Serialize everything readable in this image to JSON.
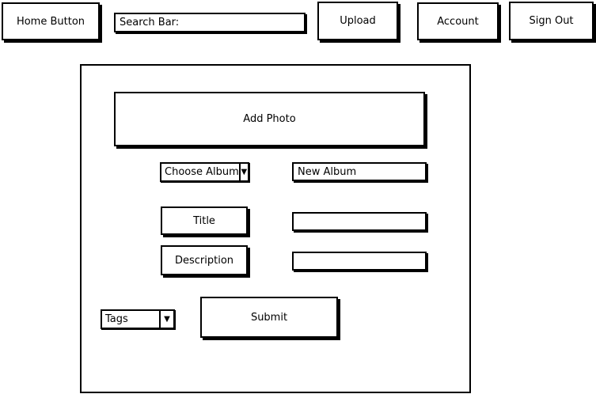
{
  "nav": {
    "home_label": "Home Button",
    "search_label": "Search Bar:",
    "upload_label": "Upload",
    "account_label": "Account",
    "signout_label": "Sign Out"
  },
  "form": {
    "add_photo_label": "Add Photo",
    "album_select": {
      "selected": "Choose Album",
      "arrow_icon": "triangle-down-icon"
    },
    "new_album_value": "New Album",
    "title_label": "Title",
    "title_value": "",
    "description_label": "Description",
    "description_value": "",
    "tags_select": {
      "selected": "Tags",
      "arrow_icon": "triangle-down-icon"
    },
    "submit_label": "Submit"
  },
  "colors": {
    "line": "#000000",
    "background": "#ffffff"
  }
}
